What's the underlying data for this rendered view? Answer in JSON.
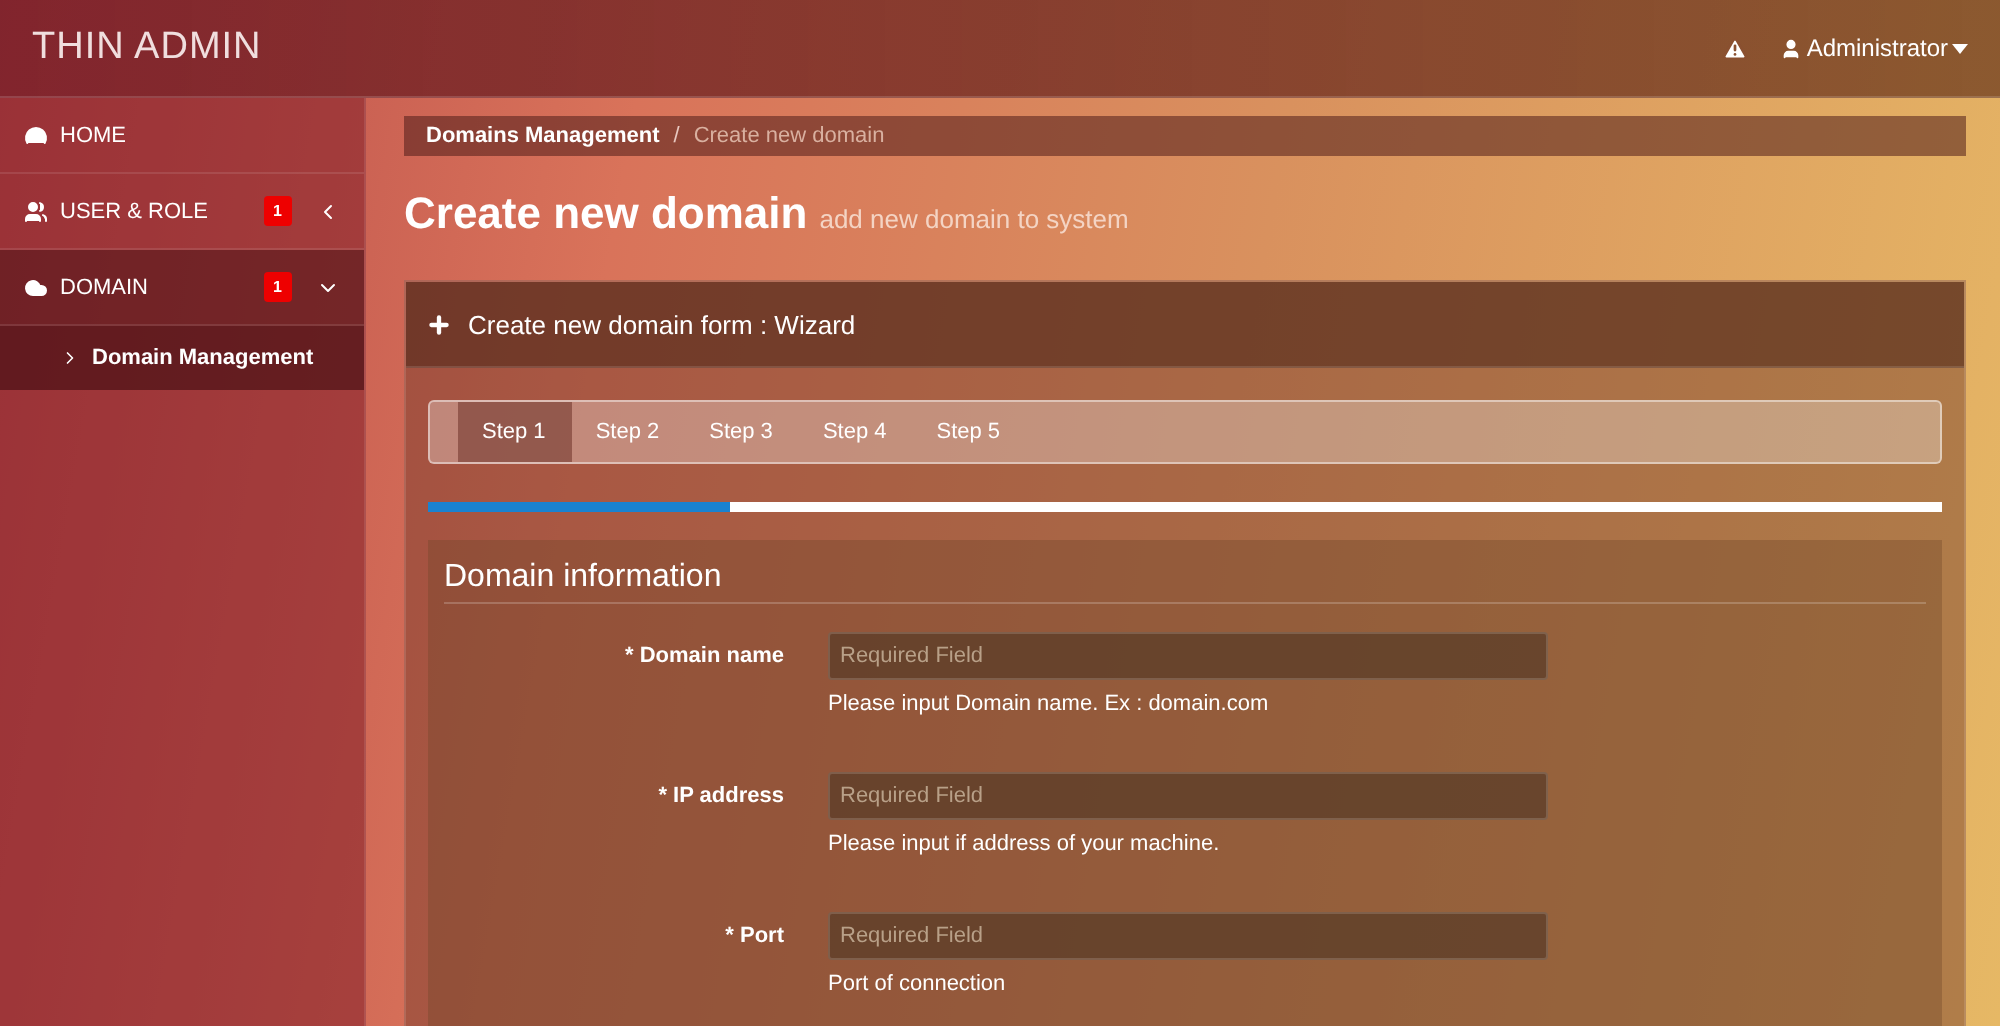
{
  "header": {
    "brand": "THIN ADMIN",
    "user": "Administrator"
  },
  "sidebar": {
    "items": [
      {
        "label": "HOME",
        "selected": false
      },
      {
        "label": "USER & ROLE",
        "badge": "1",
        "selected": false,
        "expanded": false
      },
      {
        "label": "DOMAIN",
        "badge": "1",
        "selected": true,
        "expanded": true,
        "children": [
          {
            "label": "Domain Management",
            "selected": true
          }
        ]
      }
    ]
  },
  "breadcrumb": {
    "separator": "/",
    "items": [
      {
        "label": "Domains Management",
        "current": false
      },
      {
        "label": "Create new domain",
        "current": true
      }
    ]
  },
  "page": {
    "title": "Create new domain",
    "subtitle": "add new domain to system"
  },
  "panel": {
    "title": "Create new domain form : Wizard",
    "steps": [
      {
        "label": "Step 1",
        "selected": true
      },
      {
        "label": "Step 2",
        "selected": false
      },
      {
        "label": "Step 3",
        "selected": false
      },
      {
        "label": "Step 4",
        "selected": false
      },
      {
        "label": "Step 5",
        "selected": false
      }
    ],
    "progress": {
      "level": 0.2
    },
    "section": "Domain information",
    "fields": [
      {
        "label": "* Domain name",
        "placeholder": "Required Field",
        "help": "Please input Domain name. Ex : domain.com"
      },
      {
        "label": "* IP address",
        "placeholder": "Required Field",
        "help": "Please input if address of your machine."
      },
      {
        "label": "* Port",
        "placeholder": "Required Field",
        "help": "Port of connection"
      }
    ]
  }
}
